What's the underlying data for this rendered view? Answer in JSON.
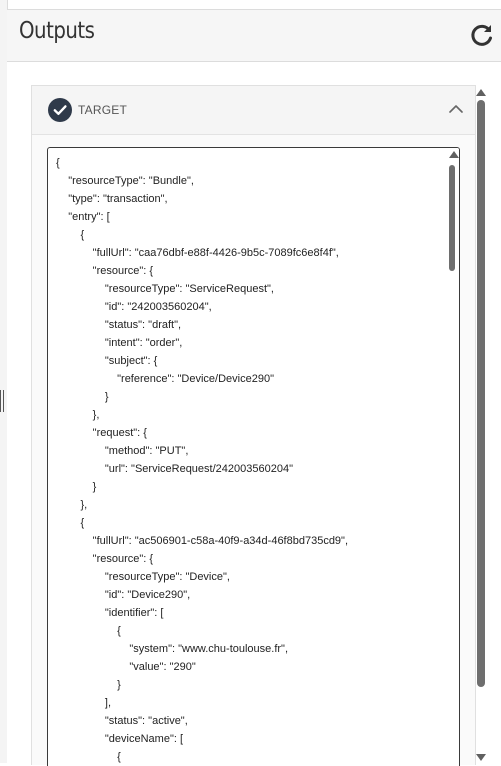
{
  "outputs": {
    "title": "Outputs",
    "refresh_icon": "refresh-icon"
  },
  "section": {
    "title": "TARGET",
    "status_icon": "check-circle-icon",
    "toggle_icon": "chevron-up-icon",
    "accent_color": "#2f3a4a"
  },
  "code": {
    "lines": [
      "{",
      "    \"resourceType\": \"Bundle\",",
      "    \"type\": \"transaction\",",
      "    \"entry\": [",
      "        {",
      "            \"fullUrl\": \"caa76dbf-e88f-4426-9b5c-7089fc6e8f4f\",",
      "            \"resource\": {",
      "                \"resourceType\": \"ServiceRequest\",",
      "                \"id\": \"242003560204\",",
      "                \"status\": \"draft\",",
      "                \"intent\": \"order\",",
      "                \"subject\": {",
      "                    \"reference\": \"Device/Device290\"",
      "                }",
      "            },",
      "            \"request\": {",
      "                \"method\": \"PUT\",",
      "                \"url\": \"ServiceRequest/242003560204\"",
      "            }",
      "        },",
      "        {",
      "            \"fullUrl\": \"ac506901-c58a-40f9-a34d-46f8bd735cd9\",",
      "            \"resource\": {",
      "                \"resourceType\": \"Device\",",
      "                \"id\": \"Device290\",",
      "                \"identifier\": [",
      "                    {",
      "                        \"system\": \"www.chu-toulouse.fr\",",
      "                        \"value\": \"290\"",
      "                    }",
      "                ],",
      "                \"status\": \"active\",",
      "                \"deviceName\": [",
      "                    {"
    ]
  }
}
